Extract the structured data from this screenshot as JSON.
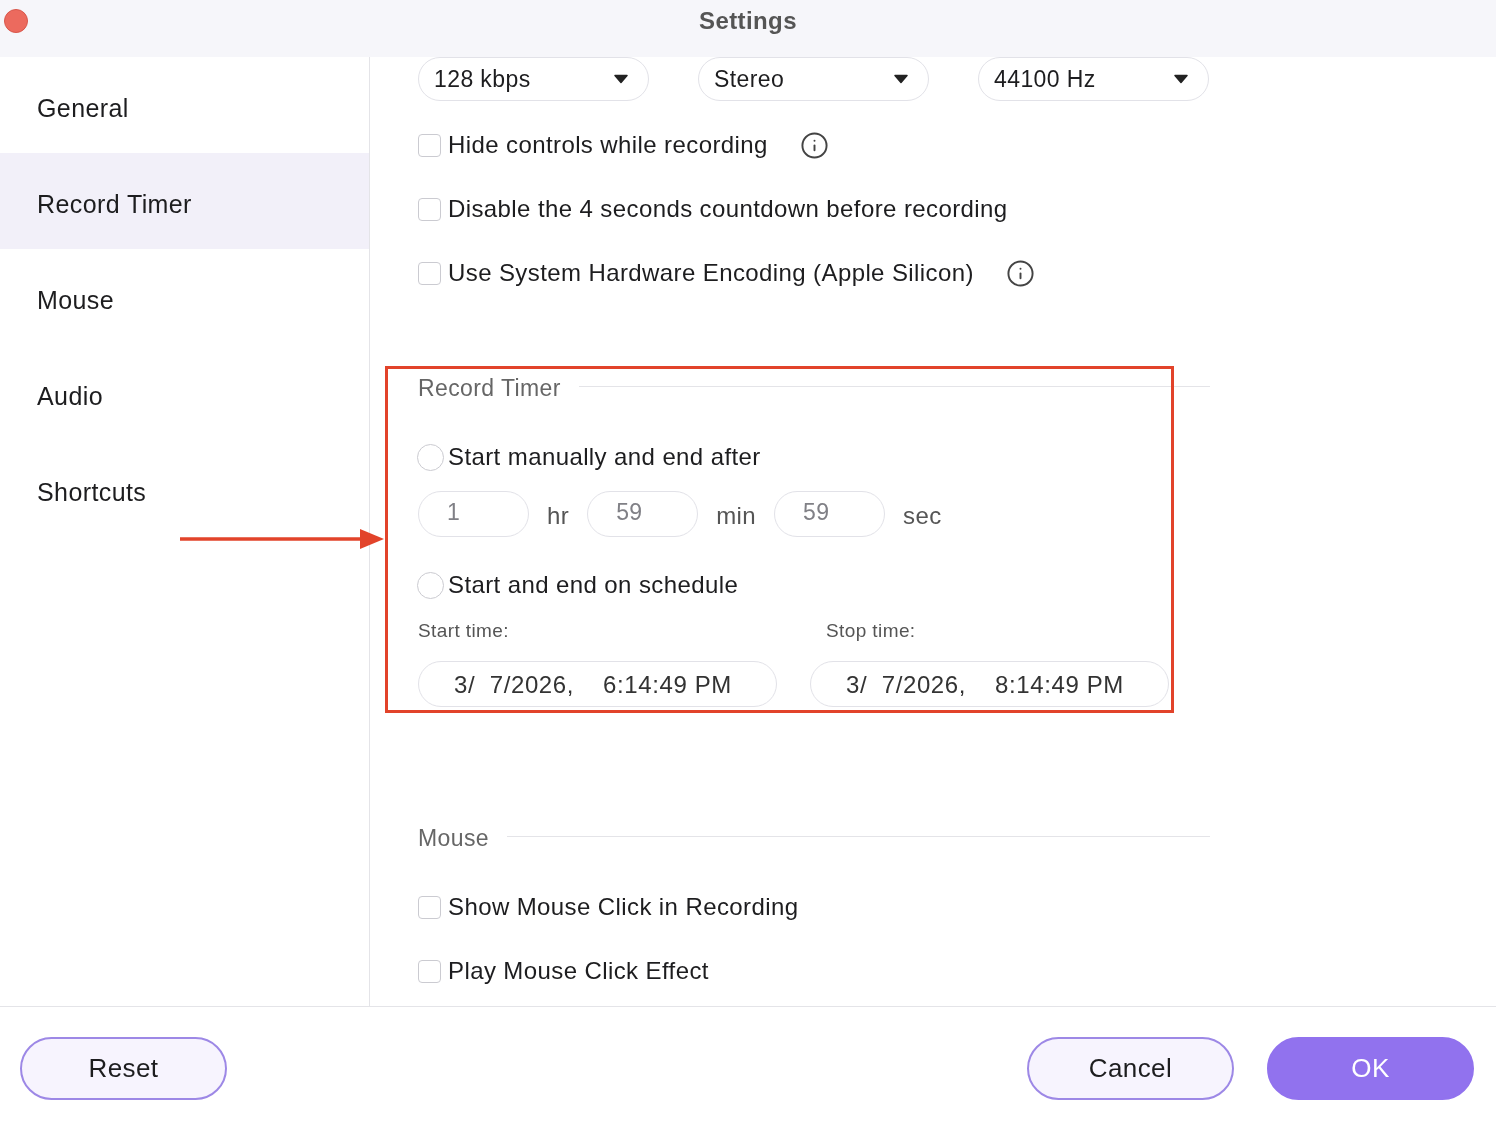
{
  "window": {
    "title": "Settings"
  },
  "sidebar": {
    "items": [
      {
        "label": "General",
        "selected": false
      },
      {
        "label": "Record Timer",
        "selected": true
      },
      {
        "label": "Mouse",
        "selected": false
      },
      {
        "label": "Audio",
        "selected": false
      },
      {
        "label": "Shortcuts",
        "selected": false
      }
    ]
  },
  "audio_dropdowns": [
    {
      "value": "128 kbps"
    },
    {
      "value": "Stereo"
    },
    {
      "value": "44100 Hz"
    }
  ],
  "options": [
    {
      "label": "Hide controls while recording",
      "checked": false,
      "info": true
    },
    {
      "label": "Disable the 4 seconds countdown before recording",
      "checked": false
    },
    {
      "label": "Use System Hardware Encoding (Apple Silicon)",
      "checked": false,
      "info": true
    }
  ],
  "record_timer": {
    "heading": "Record Timer",
    "modes": [
      {
        "label": "Start manually and end after",
        "selected": false
      },
      {
        "label": "Start and end on schedule",
        "selected": false
      }
    ],
    "duration": [
      {
        "value": "1",
        "unit": "hr",
        "disabled": true
      },
      {
        "value": "59",
        "unit": "min",
        "disabled": true
      },
      {
        "value": "59",
        "unit": "sec",
        "disabled": true
      }
    ],
    "schedule": [
      {
        "label": "Start time:",
        "value": "3/  7/2026,    6:14:49 PM"
      },
      {
        "label": "Stop time:",
        "value": "3/  7/2026,    8:14:49 PM"
      }
    ]
  },
  "mouse": {
    "heading": "Mouse",
    "options": [
      {
        "label": "Show Mouse Click in Recording",
        "checked": false
      },
      {
        "label": "Play Mouse Click Effect",
        "checked": false
      }
    ]
  },
  "footer": {
    "left": [
      {
        "label": "Reset",
        "kind": "secondary"
      }
    ],
    "right": [
      {
        "label": "Cancel",
        "kind": "secondary"
      },
      {
        "label": "OK",
        "kind": "primary"
      }
    ]
  }
}
